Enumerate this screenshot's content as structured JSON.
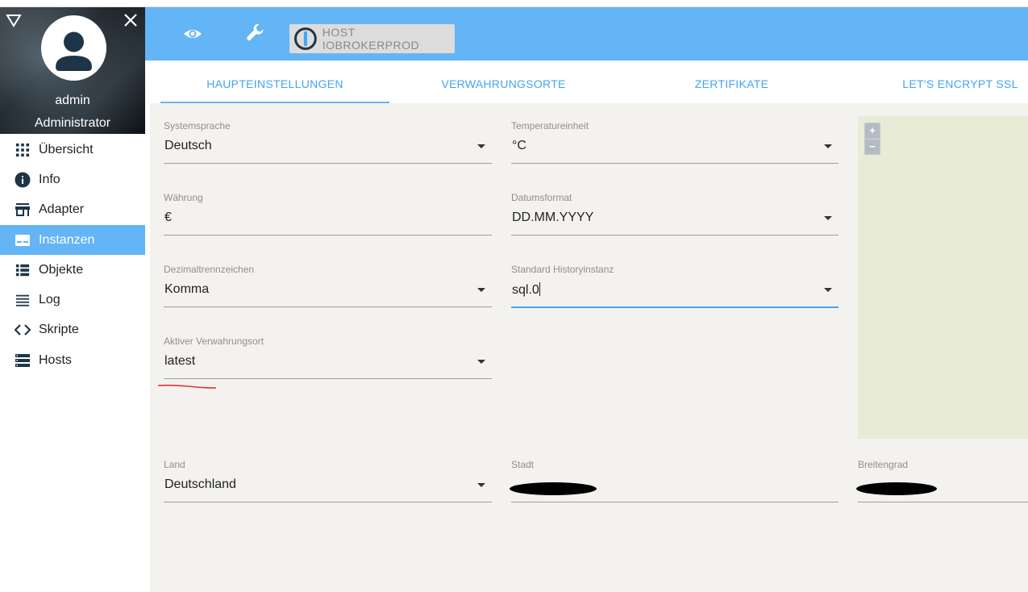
{
  "sidebar": {
    "username": "admin",
    "role": "Administrator",
    "items": [
      {
        "label": "Übersicht",
        "icon": "grid-icon",
        "active": false
      },
      {
        "label": "Info",
        "icon": "info-icon",
        "active": false
      },
      {
        "label": "Adapter",
        "icon": "store-icon",
        "active": false
      },
      {
        "label": "Instanzen",
        "icon": "instances-icon",
        "active": true
      },
      {
        "label": "Objekte",
        "icon": "list-icon",
        "active": false
      },
      {
        "label": "Log",
        "icon": "lines-icon",
        "active": false
      },
      {
        "label": "Skripte",
        "icon": "code-icon",
        "active": false
      },
      {
        "label": "Hosts",
        "icon": "storage-icon",
        "active": false
      }
    ]
  },
  "appbar": {
    "host_label": "HOST IOBROKERPROD"
  },
  "tabs": [
    {
      "label": "HAUPTEINSTELLUNGEN",
      "active": true
    },
    {
      "label": "VERWAHRUNGSORTE",
      "active": false
    },
    {
      "label": "ZERTIFIKATE",
      "active": false
    },
    {
      "label": "LET'S ENCRYPT SSL",
      "active": false
    }
  ],
  "form": {
    "systemsprache": {
      "label": "Systemsprache",
      "value": "Deutsch"
    },
    "temperatureinheit": {
      "label": "Temperatureinheit",
      "value": "°C"
    },
    "waehrung": {
      "label": "Währung",
      "value": "€"
    },
    "datumsformat": {
      "label": "Datumsformat",
      "value": "DD.MM.YYYY"
    },
    "dezimaltrennzeichen": {
      "label": "Dezimaltrennzeichen",
      "value": "Komma"
    },
    "historyinstanz": {
      "label": "Standard Historyinstanz",
      "value": "sql.0"
    },
    "verwahrungsort": {
      "label": "Aktiver Verwahrungsort",
      "value": "latest"
    },
    "land": {
      "label": "Land",
      "value": "Deutschland"
    },
    "stadt": {
      "label": "Stadt",
      "value": ""
    },
    "breitengrad": {
      "label": "Breitengrad",
      "value": ""
    }
  },
  "map": {
    "zoom_in": "+",
    "zoom_out": "−"
  },
  "colors": {
    "primary": "#64b5f6",
    "tab_text": "#42a5f5",
    "content_bg": "#f4f2ef",
    "map_bg": "#e8ebd6"
  }
}
